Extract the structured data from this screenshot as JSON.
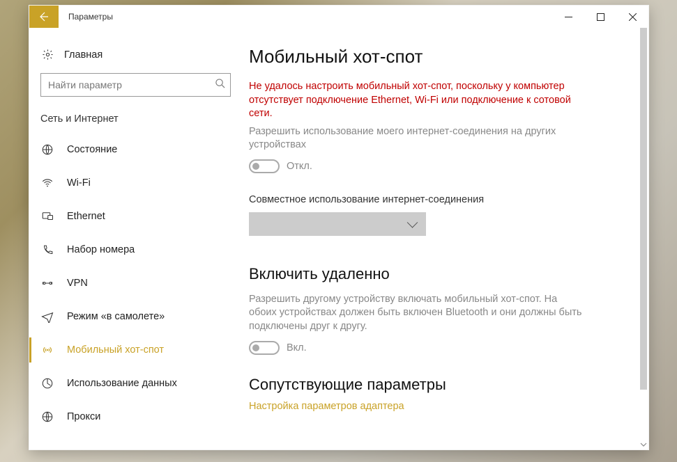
{
  "window": {
    "title": "Параметры"
  },
  "sidebar": {
    "home": "Главная",
    "search_placeholder": "Найти параметр",
    "group": "Сеть и Интернет",
    "items": [
      {
        "label": "Состояние"
      },
      {
        "label": "Wi-Fi"
      },
      {
        "label": "Ethernet"
      },
      {
        "label": "Набор номера"
      },
      {
        "label": "VPN"
      },
      {
        "label": "Режим «в самолете»"
      },
      {
        "label": "Мобильный хот-спот"
      },
      {
        "label": "Использование данных"
      },
      {
        "label": "Прокси"
      }
    ],
    "selected_index": 6
  },
  "content": {
    "title": "Мобильный хот-спот",
    "error": "Не удалось настроить мобильный хот-спот, поскольку у компьютер отсутствует подключение Ethernet, Wi-Fi или подключение к сотовой сети.",
    "share_desc": "Разрешить использование моего интернет-соединения на других устройствах",
    "share_toggle_label": "Откл.",
    "share_toggle_on": false,
    "dropdown_label": "Совместное использование интернет-соединения",
    "remote_title": "Включить удаленно",
    "remote_desc": "Разрешить другому устройству включать мобильный хот-спот. На обоих устройствах должен быть включен Bluetooth и они должны быть подключены друг к другу.",
    "remote_toggle_label": "Вкл.",
    "remote_toggle_on": false,
    "related_title": "Сопутствующие параметры",
    "related_link": "Настройка параметров адаптера"
  },
  "colors": {
    "accent": "#c9a227",
    "error": "#c00000"
  }
}
